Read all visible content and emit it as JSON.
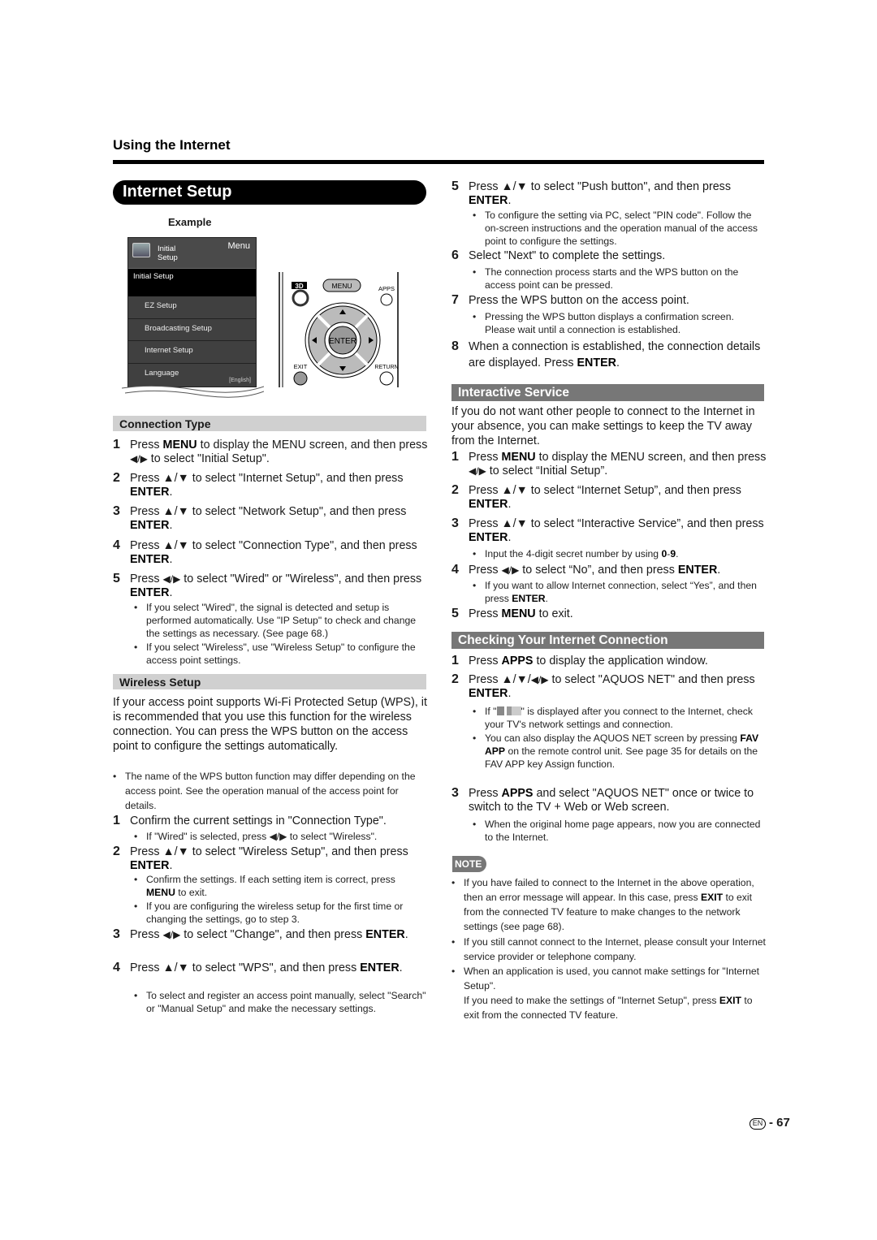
{
  "header": {
    "section": "Using the Internet",
    "title": "Internet Setup",
    "example_label": "Example"
  },
  "tv_menu": {
    "header_title_line1": "Initial",
    "header_title_line2": "Setup",
    "menu_label": "Menu",
    "selected": "Initial Setup",
    "items": [
      {
        "label": "EZ Setup"
      },
      {
        "label": "Broadcasting Setup"
      },
      {
        "label": "Internet Setup"
      },
      {
        "label": "Language",
        "value": "[English]"
      }
    ]
  },
  "remote": {
    "btn_3d": "3D",
    "btn_menu": "MENU",
    "btn_apps": "APPS",
    "btn_enter": "ENTER",
    "btn_exit": "EXIT",
    "btn_return": "RETURN"
  },
  "connection_type": {
    "title": "Connection Type",
    "steps": [
      {
        "n": "1",
        "html": "Press <b>MENU</b> to display the MENU screen, and then press <span class='arr'>◀/▶</span> to select \"Initial Setup\"."
      },
      {
        "n": "2",
        "html": "Press ▲/▼ to select \"Internet Setup\", and then press <b>ENTER</b>."
      },
      {
        "n": "3",
        "html": "Press ▲/▼ to select \"Network Setup\", and then press <b>ENTER</b>."
      },
      {
        "n": "4",
        "html": "Press ▲/▼ to select \"Connection Type\", and then press <b>ENTER</b>."
      },
      {
        "n": "5",
        "html": "Press <span class='arr'>◀/▶</span> to select \"Wired\" or \"Wireless\", and then press <b>ENTER</b>."
      }
    ],
    "bullets": [
      "If you select \"Wired\", the signal is detected and setup is performed automatically. Use \"IP Setup\" to check and change the settings as necessary. (See page 68.)",
      "If you select \"Wireless\", use \"Wireless Setup\" to configure the access point settings."
    ]
  },
  "wireless_setup": {
    "title": "Wireless Setup",
    "intro": "If your access point supports Wi-Fi Protected Setup (WPS), it is recommended that you use this function for the wireless connection. You can press the WPS button on the access point to configure the settings automatically.",
    "intro_bullet": "The name of the WPS button function may differ depending on the access point. See the operation manual of the access point for details.",
    "steps": [
      {
        "n": "1",
        "html": "Confirm the current settings in \"Connection Type\"."
      },
      {
        "n": "2",
        "html": "Press ▲/▼ to select \"Wireless Setup\", and then press <b>ENTER</b>."
      },
      {
        "n": "3",
        "html": "Press <span class='arr'>◀/▶</span> to select \"Change\", and then press <b>ENTER</b>."
      },
      {
        "n": "4",
        "html": "Press ▲/▼ to select \"WPS\", and then press <b>ENTER</b>."
      },
      {
        "n": "5",
        "html": "Press ▲/▼ to select \"Push button\", and then press <b>ENTER</b>."
      },
      {
        "n": "6",
        "html": "Select \"Next\" to complete the settings."
      },
      {
        "n": "7",
        "html": "Press the WPS button on the access point."
      },
      {
        "n": "8",
        "html": "When a connection is established, the connection details are displayed. Press <b>ENTER</b>."
      }
    ],
    "bullets": {
      "s1": "If \"Wired\" is selected, press <span class='arr'>◀/▶</span> to select \"Wireless\".",
      "s2a": "Confirm the settings. If each setting item is correct, press <b>MENU</b> to exit.",
      "s2b": "If you are configuring the wireless setup for the first time or changing the settings, go to step 3.",
      "s4": "To select and register an access point manually, select \"Search\" or \"Manual Setup\" and make the necessary settings.",
      "s5": "To configure the setting via PC, select \"PIN code\". Follow the on-screen instructions and the operation manual of the access point to configure the settings.",
      "s6": "The connection process starts and the WPS button on the access point can be pressed.",
      "s7": "Pressing the WPS button displays a confirmation screen. Please wait until a connection is established."
    }
  },
  "interactive_service": {
    "title": "Interactive Service",
    "intro": "If you do not want other people to connect to the Internet in your absence, you can make settings to keep the TV away from the Internet.",
    "steps": [
      {
        "n": "1",
        "html": "Press <b>MENU</b> to display the MENU screen, and then press <span class='arr'>◀/▶</span> to select “Initial Setup”."
      },
      {
        "n": "2",
        "html": "Press ▲/▼ to select “Internet Setup”, and then press <b>ENTER</b>."
      },
      {
        "n": "3",
        "html": "Press ▲/▼ to select “Interactive Service”, and then press <b>ENTER</b>."
      },
      {
        "n": "4",
        "html": "Press <span class='arr'>◀/▶</span> to select “No”, and then press <b>ENTER</b>."
      },
      {
        "n": "5",
        "html": "Press <b>MENU</b> to exit."
      }
    ],
    "bullets": {
      "s3": "Input the 4-digit secret number by using <b>0</b>-<b>9</b>.",
      "s4": "If you want to allow Internet connection, select “Yes”, and then press <b>ENTER</b>."
    }
  },
  "checking": {
    "title": "Checking Your Internet Connection",
    "steps": [
      {
        "n": "1",
        "html": "Press <b>APPS</b> to display the application window."
      },
      {
        "n": "2",
        "html": "Press ▲/▼/<span class='arr'>◀/▶</span> to select \"AQUOS NET\" and then press <b>ENTER</b>."
      },
      {
        "n": "3",
        "html": "Press <b>APPS</b> and select \"AQUOS NET\" once or twice to switch to the TV + Web or Web screen."
      }
    ],
    "bullets": {
      "s2a": "If \"<span class='disc-icon' data-name='network-disconnected-icon'></span>\" is displayed after you connect to the Internet, check your TV's network settings and connection.",
      "s2b": "You can also display the AQUOS NET screen by pressing <b>FAV APP</b> on the remote control unit. See page 35 for details on the FAV APP key Assign function.",
      "s3": "When the original home page appears, now you are connected to the Internet."
    }
  },
  "note": {
    "label": "NOTE",
    "bullets": [
      "If you have failed to connect to the Internet in the above operation, then an error message will appear. In this case, press <b>EXIT</b> to exit from the connected TV feature to make changes to the network settings (see page 68).",
      "If you still cannot connect to the Internet, please consult your Internet service provider or telephone company.",
      "When an application is used, you cannot make settings for \"Internet Setup\".<br>If you need to make the settings of \"Internet Setup\", press <b>EXIT</b> to exit from the connected TV feature."
    ]
  },
  "footer": {
    "lang": "EN",
    "page": "67"
  }
}
